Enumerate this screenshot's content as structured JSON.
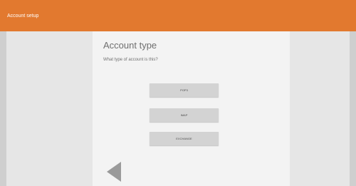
{
  "appbar": {
    "title": "Account setup",
    "color": "#e2792f"
  },
  "main": {
    "heading": "Account type",
    "subheading": "What type of account is this?",
    "options": [
      {
        "label": "POP3"
      },
      {
        "label": "IMAP"
      },
      {
        "label": "EXCHANGE"
      }
    ],
    "back_icon": "back-arrow-icon"
  }
}
